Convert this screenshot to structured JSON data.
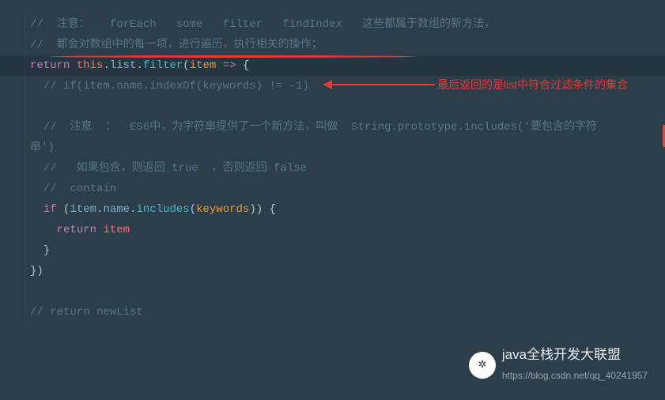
{
  "code": {
    "l1": "//  注意：   forEach   some   filter   findIndex   这些都属于数组的新方法，",
    "l2": "//  都会对数组中的每一项，进行遍历，执行相关的操作；",
    "l3_return": "return",
    "l3_this": "this",
    "l3_list": "list",
    "l3_filter": "filter",
    "l3_item": "item",
    "l3_arrow": "=>",
    "l4": "  // if(item.name.indexOf(keywords) != -1)",
    "l6": "  //  注意  ：  ES6中，为字符串提供了一个新方法，叫做  String.prototype.includes('要包含的字符串')",
    "l7": "  //   如果包含，则返回 true  ，否则返回 false",
    "l8": "  //  contain",
    "l9_if": "if",
    "l9_item": "item",
    "l9_name": "name",
    "l9_includes": "includes",
    "l9_keywords": "keywords",
    "l10_return": "return",
    "l10_item": "item",
    "l11": "  }",
    "l12": "})",
    "l14": "// return newList"
  },
  "annotation": "最后返回的是list中符合过滤条件的集合",
  "watermark": {
    "title": "java全栈开发大联盟",
    "url": "https://blog.csdn.net/qq_40241957"
  }
}
